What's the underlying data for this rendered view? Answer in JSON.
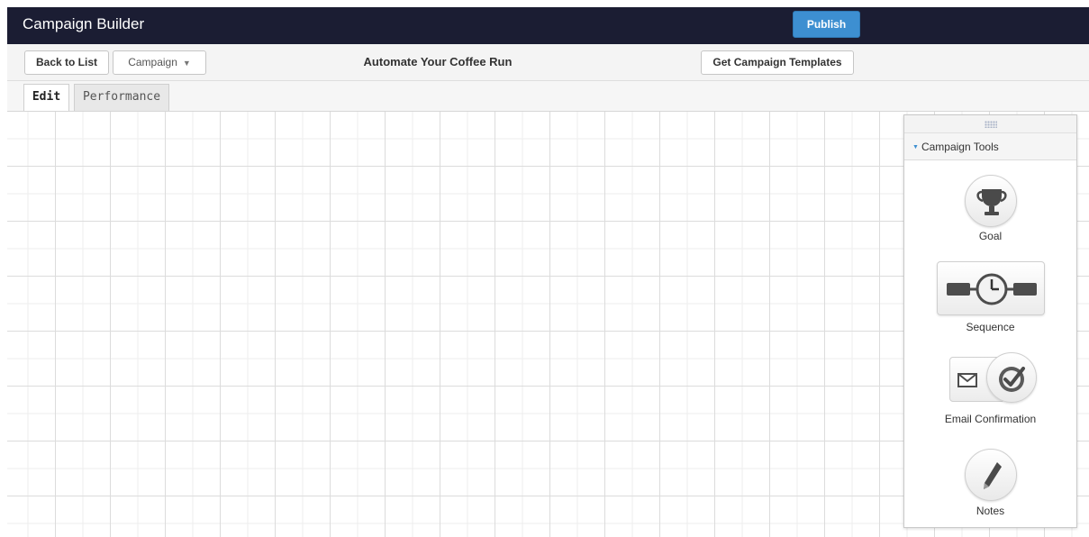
{
  "header": {
    "title": "Campaign Builder",
    "publish_label": "Publish"
  },
  "toolbar": {
    "back_label": "Back to List",
    "campaign_select_value": "Campaign",
    "campaign_name": "Automate Your Coffee Run",
    "templates_label": "Get Campaign Templates"
  },
  "tabs": [
    {
      "label": "Edit",
      "active": true
    },
    {
      "label": "Performance",
      "active": false
    }
  ],
  "tools_panel": {
    "title": "Campaign Tools",
    "items": [
      {
        "label": "Goal",
        "icon": "trophy-icon"
      },
      {
        "label": "Sequence",
        "icon": "sequence-clock-icon"
      },
      {
        "label": "Email Confirmation",
        "icon": "email-check-icon"
      },
      {
        "label": "Notes",
        "icon": "pencil-icon"
      }
    ]
  },
  "colors": {
    "header_bg": "#1b1d33",
    "accent": "#3d8fd1"
  }
}
